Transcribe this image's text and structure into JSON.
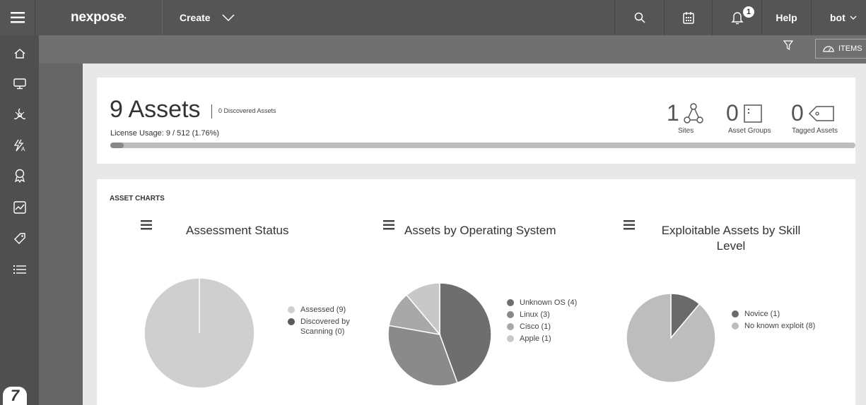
{
  "topbar": {
    "logo": "nexpose",
    "create_label": "Create",
    "notification_count": "1",
    "help_label": "Help",
    "user_label": "bot"
  },
  "sidebar": {
    "items": [
      "home-icon",
      "monitor-icon",
      "biohazard-icon",
      "policy-icon",
      "ribbon-icon",
      "chart-icon",
      "tag-icon",
      "list-icon"
    ],
    "logo_text": "7"
  },
  "subbar": {
    "items_label": "ITEMS"
  },
  "summary": {
    "assets_title": "9 Assets",
    "discovered_label": "0 Discovered Assets",
    "license_usage": "License Usage: 9 / 512 (1.76%)",
    "license_fraction": 0.0176,
    "stats": [
      {
        "value": "1",
        "label": "Sites",
        "icon": "sites-icon"
      },
      {
        "value": "0",
        "label": "Asset Groups",
        "icon": "asset-groups-icon"
      },
      {
        "value": "0",
        "label": "Tagged Assets",
        "icon": "tag-icon"
      }
    ]
  },
  "charts_heading": "ASSET CHARTS",
  "chart_data": [
    {
      "type": "pie",
      "title": "Assessment Status",
      "categories": [
        "Assessed (9)",
        "Discovered by Scanning (0)"
      ],
      "values": [
        9,
        0
      ],
      "colors": [
        "#cfcfcf",
        "#5a5a5a"
      ]
    },
    {
      "type": "pie",
      "title": "Assets by Operating System",
      "categories": [
        "Unknown OS (4)",
        "Linux (3)",
        "Cisco (1)",
        "Apple (1)"
      ],
      "values": [
        4,
        3,
        1,
        1
      ],
      "colors": [
        "#6e6e6e",
        "#8a8a8a",
        "#a8a8a8",
        "#c8c8c8"
      ]
    },
    {
      "type": "pie",
      "title": "Exploitable Assets by Skill Level",
      "categories": [
        "Novice (1)",
        "No known exploit (8)"
      ],
      "values": [
        1,
        8
      ],
      "colors": [
        "#6a6a6a",
        "#bdbdbd"
      ]
    }
  ]
}
